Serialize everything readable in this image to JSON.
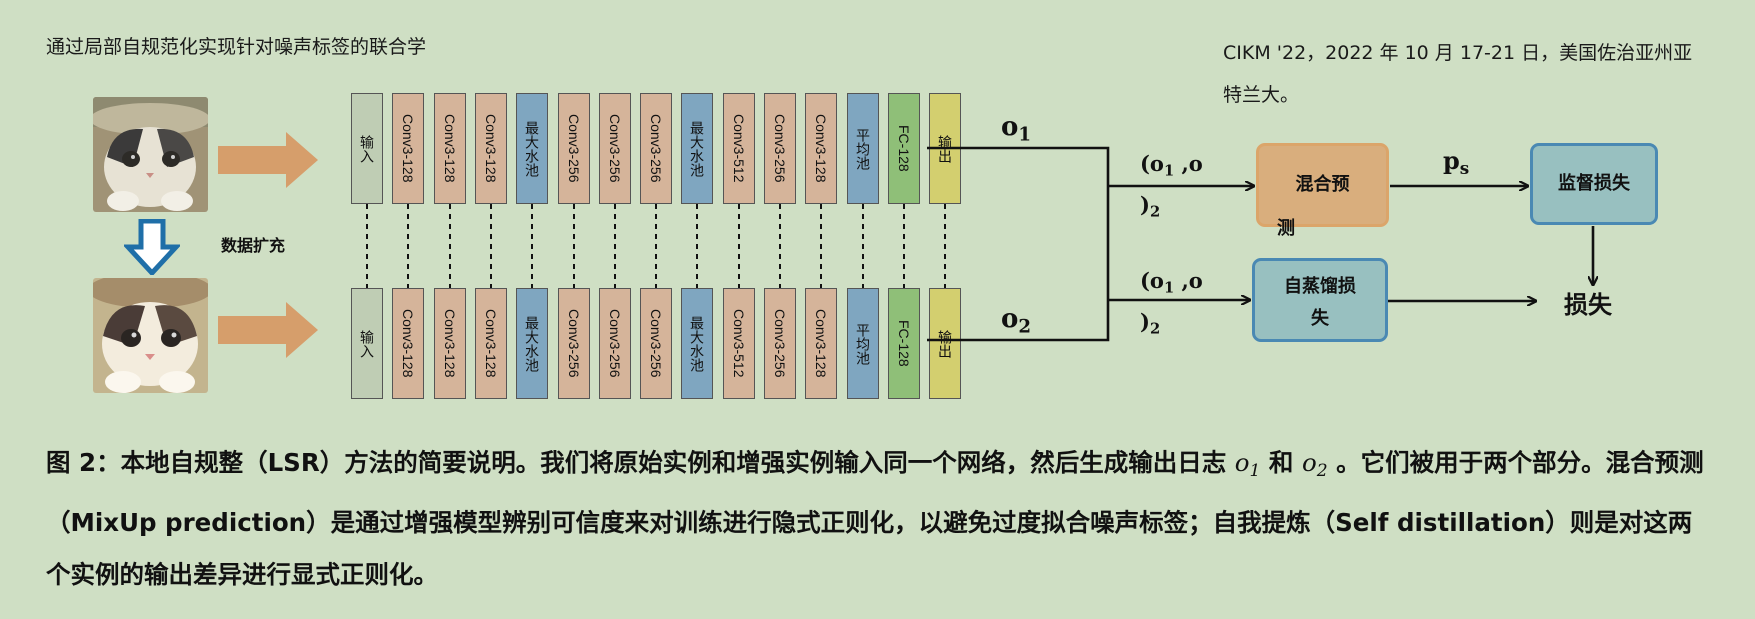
{
  "header": {
    "left": "通过局部自规范化实现针对噪声标签的联合学",
    "right": "CIKM '22，2022 年 10 月 17-21 日，美国佐治亚州亚特兰大。"
  },
  "figure": {
    "augment_label": "数据扩充",
    "layers": [
      {
        "label": "输入",
        "kind": "input"
      },
      {
        "label": "Conv3-128",
        "kind": "conv"
      },
      {
        "label": "Conv3-128",
        "kind": "conv"
      },
      {
        "label": "Conv3-128",
        "kind": "conv"
      },
      {
        "label": "最大水池",
        "kind": "pool"
      },
      {
        "label": "Conv3-256",
        "kind": "conv"
      },
      {
        "label": "Conv3-256",
        "kind": "conv"
      },
      {
        "label": "Conv3-256",
        "kind": "conv"
      },
      {
        "label": "最大水池",
        "kind": "pool"
      },
      {
        "label": "Conv3-512",
        "kind": "conv"
      },
      {
        "label": "Conv3-256",
        "kind": "conv"
      },
      {
        "label": "Conv3-128",
        "kind": "conv"
      },
      {
        "label": "平均池",
        "kind": "pool"
      },
      {
        "label": "FC-128",
        "kind": "fc"
      },
      {
        "label": "输出",
        "kind": "out"
      }
    ],
    "o1": "o",
    "o1_sub": "1",
    "o2": "o",
    "o2_sub": "2",
    "pair_a": "(o",
    "pair_sub1": "1",
    "pair_b": " ,o",
    "pair_c": ")",
    "pair_sub2": "2",
    "ps": "p",
    "ps_sub": "s",
    "mixup_line1": "混合预",
    "mixup_line2": "测",
    "supervised_loss": "监督损失",
    "distill_line1": "自蒸馏损",
    "distill_line2": "失",
    "loss": "损失",
    "colors": {
      "input": "#bfcdb4",
      "conv": "#d5b49a",
      "pool": "#7fa6c0",
      "fc": "#8fbf78",
      "out": "#d3cf6f",
      "arrow_orange": "#d69e6b",
      "arrow_blue": "#1f6fa8"
    }
  },
  "caption": {
    "p1": "图 2：本地自规整（LSR）方法的简要说明。我们将原始实例和增强实例输入同一个网络，然后生成输出日志 ",
    "o1": "o",
    "o1_sub": "1",
    "and": " 和 ",
    "o2": "o",
    "o2_sub": "2",
    "p2": " 。它们被用于两个部分。混合预测（MixUp prediction）是通过增强模型辨别可信度来对训练进行隐式正则化，以避免过度拟合噪声标签；自我提炼（Self distillation）则是对这两个实例的输出差异进行显式正则化。"
  }
}
